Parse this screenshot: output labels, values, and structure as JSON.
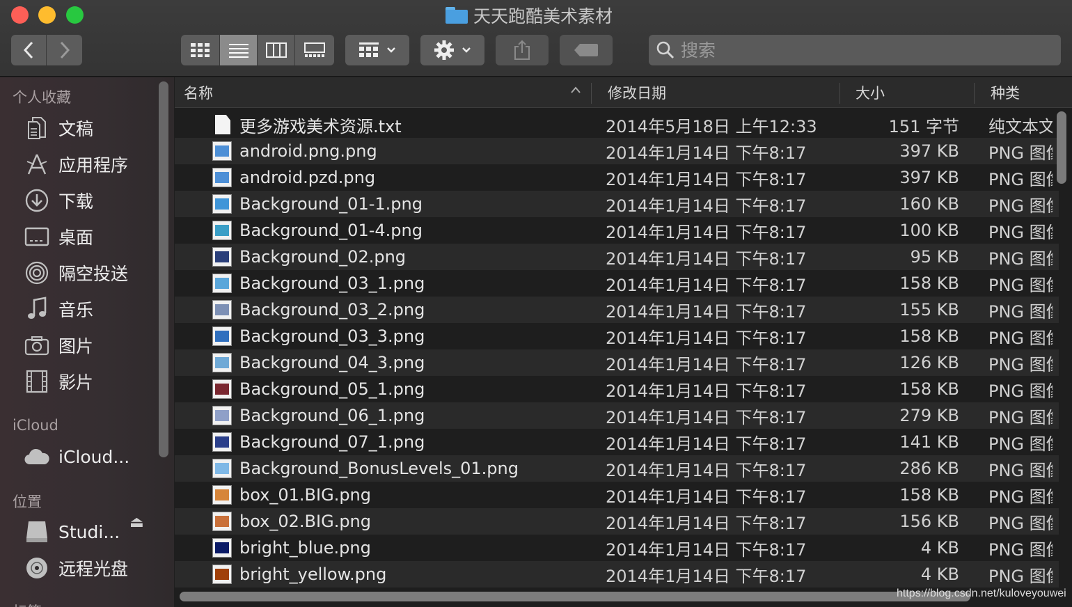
{
  "window": {
    "title": "天天跑酷美术素材"
  },
  "toolbar": {
    "back_label": "‹",
    "forward_label": "›",
    "search_placeholder": "搜索"
  },
  "sidebar": {
    "sections": {
      "favorites": "个人收藏",
      "icloud": "iCloud",
      "locations": "位置",
      "tags": "标签"
    },
    "favorites": [
      {
        "label": "文稿",
        "icon": "document-icon"
      },
      {
        "label": "应用程序",
        "icon": "applications-icon"
      },
      {
        "label": "下载",
        "icon": "download-icon"
      },
      {
        "label": "桌面",
        "icon": "desktop-icon"
      },
      {
        "label": "隔空投送",
        "icon": "airdrop-icon"
      },
      {
        "label": "音乐",
        "icon": "music-icon"
      },
      {
        "label": "图片",
        "icon": "camera-icon"
      },
      {
        "label": "影片",
        "icon": "film-icon"
      }
    ],
    "icloud_items": [
      {
        "label": "iCloud...",
        "icon": "cloud-icon"
      }
    ],
    "location_items": [
      {
        "label": "Studi...",
        "icon": "disk-icon"
      },
      {
        "label": "远程光盘",
        "icon": "optical-disc-icon"
      }
    ]
  },
  "columns": {
    "name": "名称",
    "date": "修改日期",
    "size": "大小",
    "kind": "种类"
  },
  "files": [
    {
      "name": "更多游戏美术资源.txt",
      "date": "2014年5月18日 上午12:33",
      "size": "151 字节",
      "kind": "纯文本文稿",
      "type": "txt"
    },
    {
      "name": "android.png.png",
      "date": "2014年1月14日 下午8:17",
      "size": "397 KB",
      "kind": "PNG 图像",
      "type": "img",
      "color": "#4d8fd6"
    },
    {
      "name": "android.pzd.png",
      "date": "2014年1月14日 下午8:17",
      "size": "397 KB",
      "kind": "PNG 图像",
      "type": "img",
      "color": "#4d8fd6"
    },
    {
      "name": "Background_01-1.png",
      "date": "2014年1月14日 下午8:17",
      "size": "160 KB",
      "kind": "PNG 图像",
      "type": "img",
      "color": "#3f95d8"
    },
    {
      "name": "Background_01-4.png",
      "date": "2014年1月14日 下午8:17",
      "size": "100 KB",
      "kind": "PNG 图像",
      "type": "img",
      "color": "#3a9ec6"
    },
    {
      "name": "Background_02.png",
      "date": "2014年1月14日 下午8:17",
      "size": "95 KB",
      "kind": "PNG 图像",
      "type": "img",
      "color": "#2a3f7a"
    },
    {
      "name": "Background_03_1.png",
      "date": "2014年1月14日 下午8:17",
      "size": "158 KB",
      "kind": "PNG 图像",
      "type": "img",
      "color": "#5aa6da"
    },
    {
      "name": "Background_03_2.png",
      "date": "2014年1月14日 下午8:17",
      "size": "155 KB",
      "kind": "PNG 图像",
      "type": "img",
      "color": "#7d90b5"
    },
    {
      "name": "Background_03_3.png",
      "date": "2014年1月14日 下午8:17",
      "size": "158 KB",
      "kind": "PNG 图像",
      "type": "img",
      "color": "#2f6fbe"
    },
    {
      "name": "Background_04_3.png",
      "date": "2014年1月14日 下午8:17",
      "size": "126 KB",
      "kind": "PNG 图像",
      "type": "img",
      "color": "#6fa9d6"
    },
    {
      "name": "Background_05_1.png",
      "date": "2014年1月14日 下午8:17",
      "size": "158 KB",
      "kind": "PNG 图像",
      "type": "img",
      "color": "#7a2730"
    },
    {
      "name": "Background_06_1.png",
      "date": "2014年1月14日 下午8:17",
      "size": "279 KB",
      "kind": "PNG 图像",
      "type": "img",
      "color": "#8fa0c8"
    },
    {
      "name": "Background_07_1.png",
      "date": "2014年1月14日 下午8:17",
      "size": "141 KB",
      "kind": "PNG 图像",
      "type": "img",
      "color": "#2b3f8a"
    },
    {
      "name": "Background_BonusLevels_01.png",
      "date": "2014年1月14日 下午8:17",
      "size": "286 KB",
      "kind": "PNG 图像",
      "type": "img",
      "color": "#7fb8e6"
    },
    {
      "name": "box_01.BIG.png",
      "date": "2014年1月14日 下午8:17",
      "size": "158 KB",
      "kind": "PNG 图像",
      "type": "img",
      "color": "#d6853a"
    },
    {
      "name": "box_02.BIG.png",
      "date": "2014年1月14日 下午8:17",
      "size": "156 KB",
      "kind": "PNG 图像",
      "type": "img",
      "color": "#c9703a"
    },
    {
      "name": "bright_blue.png",
      "date": "2014年1月14日 下午8:17",
      "size": "4 KB",
      "kind": "PNG 图像",
      "type": "img",
      "color": "#0a1a66"
    },
    {
      "name": "bright_yellow.png",
      "date": "2014年1月14日 下午8:17",
      "size": "4 KB",
      "kind": "PNG 图像",
      "type": "img",
      "color": "#a0400a"
    }
  ],
  "watermark": "https://blog.csdn.net/kuloveyouwei"
}
